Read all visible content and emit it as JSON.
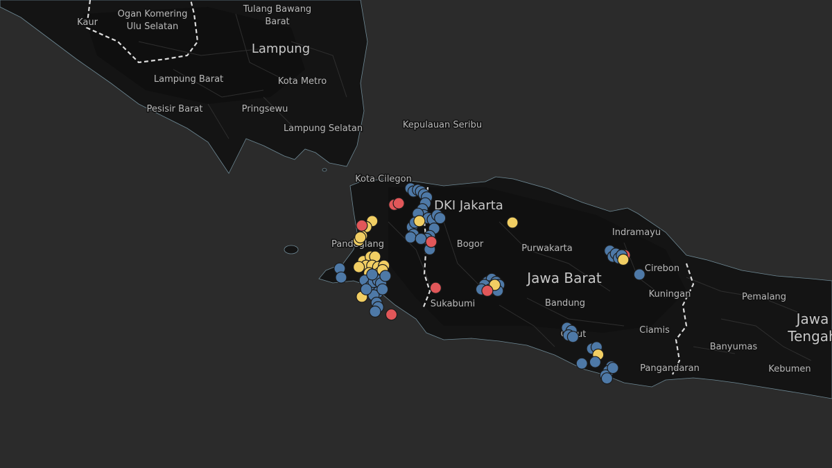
{
  "map": {
    "colors": {
      "ocean": "#2b2b2b",
      "land": "#141414",
      "blue": "#4e79a7",
      "yellow": "#f1ce63",
      "red": "#e15759",
      "label": "#b9b9b9"
    },
    "labels": {
      "kaur": "Kaur",
      "ogan1": "Ogan Komering",
      "ogan2": "Ulu Selatan",
      "tulang1": "Tulang Bawang",
      "tulang2": "Barat",
      "lampung": "Lampung",
      "lampung_barat": "Lampung Barat",
      "kota_metro": "Kota Metro",
      "pesisir_barat": "Pesisir Barat",
      "pringsewu": "Pringsewu",
      "lampung_selatan": "Lampung Selatan",
      "kepulauan_seribu": "Kepulauan Seribu",
      "kota_cilegon": "Kota Cilegon",
      "dki_jakarta": "DKI Jakarta",
      "pandeglang": "Pandeglang",
      "bogor": "Bogor",
      "purwakarta": "Purwakarta",
      "indramayu": "Indramayu",
      "cirebon": "Cirebon",
      "jawa_barat": "Jawa Barat",
      "kuningan": "Kuningan",
      "pemalang": "Pemalang",
      "sukabumi": "Sukabumi",
      "bandung": "Bandung",
      "garut": "Garut",
      "ciamis": "Ciamis",
      "banyumas": "Banyumas",
      "jawa_tengah1": "Jawa",
      "jawa_tengah2": "Tengah",
      "pangandaran": "Pangandaran",
      "kebumen": "Kebumen"
    },
    "points": [
      {
        "lon": 106.88,
        "lat": -6.1,
        "c": "blue"
      },
      {
        "lon": 106.9,
        "lat": -6.12,
        "c": "blue"
      },
      {
        "lon": 106.93,
        "lat": -6.11,
        "c": "blue"
      },
      {
        "lon": 106.95,
        "lat": -6.12,
        "c": "blue"
      },
      {
        "lon": 106.97,
        "lat": -6.14,
        "c": "blue"
      },
      {
        "lon": 106.99,
        "lat": -6.16,
        "c": "blue"
      },
      {
        "lon": 106.98,
        "lat": -6.2,
        "c": "blue"
      },
      {
        "lon": 106.96,
        "lat": -6.24,
        "c": "blue"
      },
      {
        "lon": 106.97,
        "lat": -6.28,
        "c": "blue"
      },
      {
        "lon": 107.0,
        "lat": -6.3,
        "c": "blue"
      },
      {
        "lon": 107.03,
        "lat": -6.31,
        "c": "blue"
      },
      {
        "lon": 107.06,
        "lat": -6.28,
        "c": "blue"
      },
      {
        "lon": 107.08,
        "lat": -6.3,
        "c": "blue"
      },
      {
        "lon": 107.04,
        "lat": -6.37,
        "c": "blue"
      },
      {
        "lon": 107.01,
        "lat": -6.42,
        "c": "blue"
      },
      {
        "lon": 106.99,
        "lat": -6.44,
        "c": "blue"
      },
      {
        "lon": 106.89,
        "lat": -6.36,
        "c": "blue"
      },
      {
        "lon": 106.9,
        "lat": -6.41,
        "c": "blue"
      },
      {
        "lon": 106.88,
        "lat": -6.43,
        "c": "blue"
      },
      {
        "lon": 107.01,
        "lat": -6.51,
        "c": "blue"
      },
      {
        "lon": 106.95,
        "lat": -6.44,
        "c": "blue"
      },
      {
        "lon": 106.93,
        "lat": -6.27,
        "c": "blue"
      },
      {
        "lon": 106.91,
        "lat": -6.33,
        "c": "blue"
      },
      {
        "lon": 106.94,
        "lat": -6.32,
        "c": "yellow"
      },
      {
        "lon": 106.62,
        "lat": -6.32,
        "c": "yellow"
      },
      {
        "lon": 106.58,
        "lat": -6.36,
        "c": "yellow"
      },
      {
        "lon": 106.55,
        "lat": -6.42,
        "c": "yellow"
      },
      {
        "lon": 106.53,
        "lat": -6.45,
        "c": "yellow"
      },
      {
        "lon": 106.54,
        "lat": -6.43,
        "c": "yellow"
      },
      {
        "lon": 107.57,
        "lat": -6.33,
        "c": "yellow"
      },
      {
        "lon": 106.77,
        "lat": -6.21,
        "c": "red"
      },
      {
        "lon": 106.8,
        "lat": -6.2,
        "c": "red"
      },
      {
        "lon": 106.55,
        "lat": -6.35,
        "c": "red"
      },
      {
        "lon": 107.02,
        "lat": -6.46,
        "c": "red"
      },
      {
        "lon": 107.05,
        "lat": -6.77,
        "c": "red"
      },
      {
        "lon": 106.75,
        "lat": -6.95,
        "c": "red"
      },
      {
        "lon": 108.33,
        "lat": -6.55,
        "c": "red"
      },
      {
        "lon": 106.56,
        "lat": -6.59,
        "c": "yellow"
      },
      {
        "lon": 106.61,
        "lat": -6.56,
        "c": "yellow"
      },
      {
        "lon": 106.64,
        "lat": -6.56,
        "c": "yellow"
      },
      {
        "lon": 106.58,
        "lat": -6.62,
        "c": "yellow"
      },
      {
        "lon": 106.62,
        "lat": -6.62,
        "c": "yellow"
      },
      {
        "lon": 106.66,
        "lat": -6.63,
        "c": "yellow"
      },
      {
        "lon": 106.7,
        "lat": -6.62,
        "c": "yellow"
      },
      {
        "lon": 106.6,
        "lat": -6.67,
        "c": "yellow"
      },
      {
        "lon": 106.67,
        "lat": -6.67,
        "c": "yellow"
      },
      {
        "lon": 106.53,
        "lat": -6.63,
        "c": "yellow"
      },
      {
        "lon": 106.69,
        "lat": -6.65,
        "c": "yellow"
      },
      {
        "lon": 106.55,
        "lat": -6.83,
        "c": "yellow"
      },
      {
        "lon": 106.4,
        "lat": -6.64,
        "c": "blue"
      },
      {
        "lon": 106.41,
        "lat": -6.7,
        "c": "blue"
      },
      {
        "lon": 106.57,
        "lat": -6.72,
        "c": "blue"
      },
      {
        "lon": 106.61,
        "lat": -6.76,
        "c": "blue"
      },
      {
        "lon": 106.63,
        "lat": -6.73,
        "c": "blue"
      },
      {
        "lon": 106.66,
        "lat": -6.72,
        "c": "blue"
      },
      {
        "lon": 106.68,
        "lat": -6.74,
        "c": "blue"
      },
      {
        "lon": 106.71,
        "lat": -6.69,
        "c": "blue"
      },
      {
        "lon": 106.66,
        "lat": -6.8,
        "c": "blue"
      },
      {
        "lon": 106.63,
        "lat": -6.82,
        "c": "blue"
      },
      {
        "lon": 106.65,
        "lat": -6.87,
        "c": "blue"
      },
      {
        "lon": 106.66,
        "lat": -6.9,
        "c": "blue"
      },
      {
        "lon": 106.64,
        "lat": -6.93,
        "c": "blue"
      },
      {
        "lon": 106.69,
        "lat": -6.78,
        "c": "blue"
      },
      {
        "lon": 106.58,
        "lat": -6.78,
        "c": "blue"
      },
      {
        "lon": 106.62,
        "lat": -6.68,
        "c": "blue"
      },
      {
        "lon": 107.4,
        "lat": -6.73,
        "c": "blue"
      },
      {
        "lon": 107.43,
        "lat": -6.71,
        "c": "blue"
      },
      {
        "lon": 107.46,
        "lat": -6.73,
        "c": "blue"
      },
      {
        "lon": 107.48,
        "lat": -6.75,
        "c": "blue"
      },
      {
        "lon": 107.44,
        "lat": -6.76,
        "c": "blue"
      },
      {
        "lon": 107.41,
        "lat": -6.76,
        "c": "blue"
      },
      {
        "lon": 107.38,
        "lat": -6.75,
        "c": "blue"
      },
      {
        "lon": 107.42,
        "lat": -6.78,
        "c": "blue"
      },
      {
        "lon": 107.47,
        "lat": -6.79,
        "c": "blue"
      },
      {
        "lon": 107.36,
        "lat": -6.78,
        "c": "blue"
      },
      {
        "lon": 107.45,
        "lat": -6.75,
        "c": "yellow"
      },
      {
        "lon": 107.4,
        "lat": -6.79,
        "c": "red"
      },
      {
        "lon": 108.23,
        "lat": -6.52,
        "c": "blue"
      },
      {
        "lon": 108.25,
        "lat": -6.56,
        "c": "blue"
      },
      {
        "lon": 108.27,
        "lat": -6.54,
        "c": "blue"
      },
      {
        "lon": 108.29,
        "lat": -6.57,
        "c": "blue"
      },
      {
        "lon": 108.31,
        "lat": -6.55,
        "c": "blue"
      },
      {
        "lon": 108.32,
        "lat": -6.58,
        "c": "yellow"
      },
      {
        "lon": 108.43,
        "lat": -6.68,
        "c": "blue"
      },
      {
        "lon": 107.94,
        "lat": -7.04,
        "c": "blue"
      },
      {
        "lon": 107.97,
        "lat": -7.06,
        "c": "blue"
      },
      {
        "lon": 107.95,
        "lat": -7.09,
        "c": "blue"
      },
      {
        "lon": 107.98,
        "lat": -7.1,
        "c": "blue"
      },
      {
        "lon": 108.11,
        "lat": -7.18,
        "c": "blue"
      },
      {
        "lon": 108.14,
        "lat": -7.17,
        "c": "blue"
      },
      {
        "lon": 108.15,
        "lat": -7.22,
        "c": "yellow"
      },
      {
        "lon": 108.13,
        "lat": -7.27,
        "c": "blue"
      },
      {
        "lon": 108.04,
        "lat": -7.28,
        "c": "blue"
      },
      {
        "lon": 108.24,
        "lat": -7.3,
        "c": "blue"
      },
      {
        "lon": 108.22,
        "lat": -7.33,
        "c": "blue"
      },
      {
        "lon": 108.2,
        "lat": -7.36,
        "c": "blue"
      },
      {
        "lon": 108.21,
        "lat": -7.38,
        "c": "blue"
      },
      {
        "lon": 108.25,
        "lat": -7.31,
        "c": "blue"
      }
    ]
  }
}
